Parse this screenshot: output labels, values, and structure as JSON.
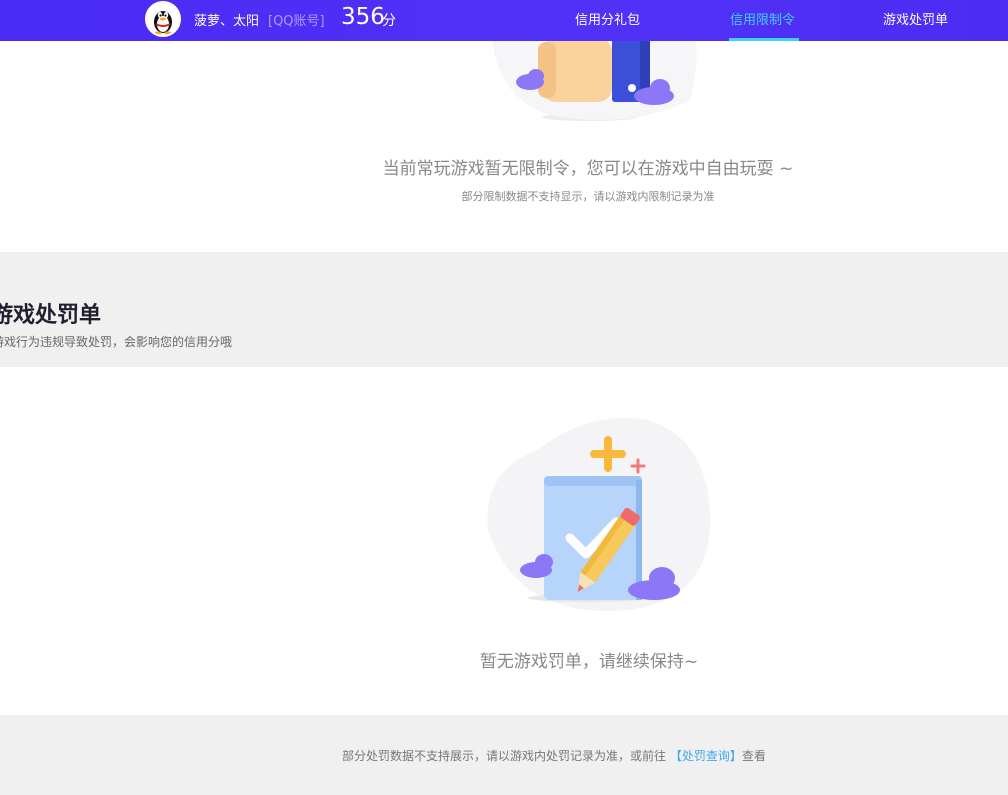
{
  "header": {
    "nickname": "菠萝、太阳",
    "account_type": "[QQ账号]",
    "score": "356",
    "score_unit": "分",
    "tabs": [
      {
        "label": "信用分礼包",
        "active": false
      },
      {
        "label": "信用限制令",
        "active": true
      },
      {
        "label": "游戏处罚单",
        "active": false
      }
    ],
    "colors": {
      "bar": "#4d2cf5",
      "active_tab": "#3ed0f5"
    }
  },
  "restriction": {
    "message": "当前常玩游戏暂无限制令，您可以在游戏中自由玩耍 ~",
    "note": "部分限制数据不支持显示，请以游戏内限制记录为准"
  },
  "penalty": {
    "title": "游戏处罚单",
    "subtitle": "游戏行为违规导致处罚，会影响您的信用分哦",
    "empty_message": "暂无游戏罚单，请继续保持~"
  },
  "footer": {
    "text_before": "部分处罚数据不支持展示，请以游戏内处罚记录为准，或前往 ",
    "link_label": "【处罚查询】",
    "text_after": "查看"
  },
  "icons": {
    "avatar": "qq-penguin-icon",
    "top_illustration": "thumbs-up-phone-illustration",
    "empty_illustration": "document-check-pencil-illustration"
  }
}
